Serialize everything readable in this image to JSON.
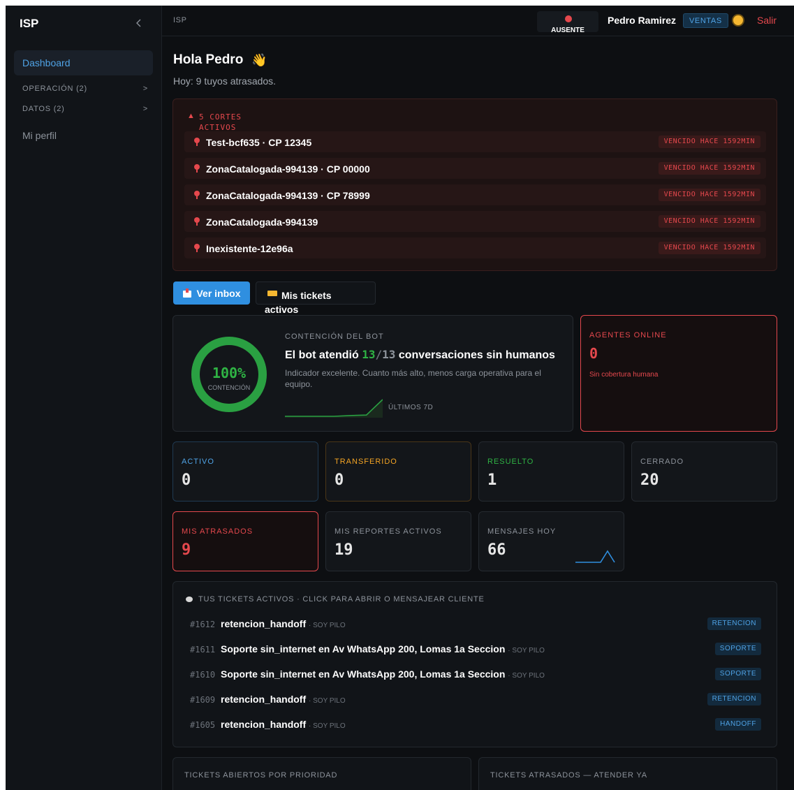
{
  "sidebar": {
    "brand": "ISP",
    "collapse_icon": "chevron-left-icon",
    "items": [
      {
        "label": "Dashboard"
      },
      {
        "label": "OPERACIÓN (2)",
        "chevron": ">"
      },
      {
        "label": "DATOS (2)",
        "chevron": ">"
      },
      {
        "label": "Mi perfil"
      }
    ]
  },
  "topbar": {
    "breadcrumb": "ISP",
    "status": "AUSENTE",
    "user": "Pedro Ramirez",
    "role": "VENTAS",
    "logout": "Salir"
  },
  "greeting": {
    "title": "Hola Pedro",
    "emoji": "👋",
    "subtitle": "Hoy: 9 tuyos atrasados."
  },
  "outages": {
    "title": "5 CORTES ACTIVOS",
    "items": [
      {
        "name": "Test-bcf635 · CP 12345",
        "badge": "VENCIDO HACE 1592MIN"
      },
      {
        "name": "ZonaCatalogada-994139 · CP 00000",
        "badge": "VENCIDO HACE 1592MIN"
      },
      {
        "name": "ZonaCatalogada-994139 · CP 78999",
        "badge": "VENCIDO HACE 1592MIN"
      },
      {
        "name": "ZonaCatalogada-994139",
        "badge": "VENCIDO HACE 1592MIN"
      },
      {
        "name": "Inexistente-12e96a",
        "badge": "VENCIDO HACE 1592MIN"
      }
    ]
  },
  "actions": {
    "inbox": "Ver inbox",
    "tickets": "Mis tickets activos"
  },
  "bot": {
    "percent": "100%",
    "percent_value": 1.0,
    "ring_label": "CONTENCIÓN",
    "label": "CONTENCIÓN DEL BOT",
    "title_pre": "El bot atendió",
    "handled": "13",
    "sep": "/",
    "total": "13",
    "title_post": "conversaciones sin humanos",
    "desc": "Indicador excelente. Cuanto más alto, menos carga operativa para el equipo.",
    "spark_label": "ÚLTIMOS 7D",
    "spark_values": [
      0,
      0,
      0,
      0,
      0.6,
      1.0,
      13
    ]
  },
  "agents": {
    "label": "AGENTES ONLINE",
    "value": "0",
    "note": "Sin cobertura humana"
  },
  "stats_row1": [
    {
      "label": "ACTIVO",
      "value": "0",
      "color": "#4fa3e6"
    },
    {
      "label": "TRANSFERIDO",
      "value": "0",
      "color": "#f5a524"
    },
    {
      "label": "RESUELTO",
      "value": "1",
      "color": "#2fb344"
    },
    {
      "label": "CERRADO",
      "value": "20",
      "color": "#8d939b"
    }
  ],
  "stats_row2": [
    {
      "label": "MIS ATRASADOS",
      "value": "9",
      "color": "#e5484d"
    },
    {
      "label": "MIS REPORTES ACTIVOS",
      "value": "19",
      "color": "#8d939b"
    },
    {
      "label": "MENSAJES HOY",
      "value": "66",
      "color": "#8d939b"
    }
  ],
  "tickets": {
    "header": "TUS TICKETS ACTIVOS · CLICK PARA ABRIR O MENSAJEAR CLIENTE",
    "rows": [
      {
        "id": "#1612",
        "title": "retencion_handoff",
        "owner": "· SOY PILO",
        "tag": "RETENCION"
      },
      {
        "id": "#1611",
        "title": "Soporte sin_internet en Av WhatsApp 200, Lomas 1a Seccion",
        "owner": "· SOY PILO",
        "tag": "SOPORTE"
      },
      {
        "id": "#1610",
        "title": "Soporte sin_internet en Av WhatsApp 200, Lomas 1a Seccion",
        "owner": "· SOY PILO",
        "tag": "SOPORTE"
      },
      {
        "id": "#1609",
        "title": "retencion_handoff",
        "owner": "· SOY PILO",
        "tag": "RETENCION"
      },
      {
        "id": "#1605",
        "title": "retencion_handoff",
        "owner": "· SOY PILO",
        "tag": "HANDOFF"
      }
    ]
  },
  "bottom": {
    "left": "TICKETS ABIERTOS POR PRIORIDAD",
    "right": "TICKETS ATRASADOS — ATENDER YA"
  }
}
